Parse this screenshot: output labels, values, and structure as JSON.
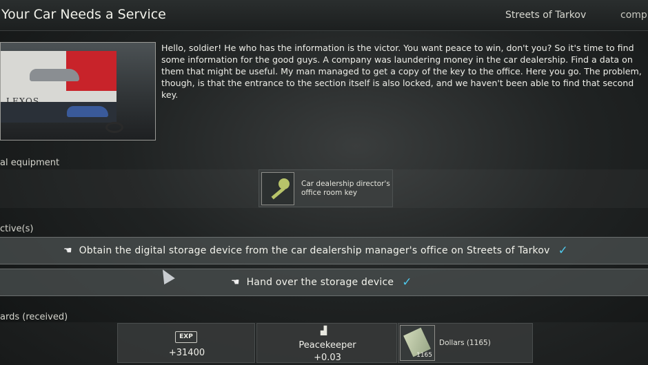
{
  "header": {
    "title": "Your Car Needs a Service",
    "location": "Streets of Tarkov",
    "status": "comp"
  },
  "briefing": {
    "image_text": "LEXOS",
    "description": "Hello, soldier! He who has the information is the victor. You want peace to win, don't you? So it's time to find some information for the good guys. A company was laundering money in the car dealership. Find a data on them that might be useful. My man managed to get a copy of the key to the office. Here you go. The problem, though, is that the entrance to the section itself is also locked, and we haven't been able to find that second key."
  },
  "equipment": {
    "label": "al equipment",
    "items": [
      {
        "name": "Car dealership director's office room key",
        "icon": "key-icon"
      }
    ]
  },
  "objectives": {
    "label": "ctive(s)",
    "items": [
      {
        "text": "Obtain the digital storage device from the car dealership manager's office on Streets of Tarkov",
        "complete": true
      },
      {
        "text": "Hand over the storage device",
        "complete": true
      }
    ]
  },
  "rewards": {
    "label": "ards",
    "status": "(received)",
    "exp": {
      "badge": "EXP",
      "value": "+31400"
    },
    "reputation": {
      "trader": "Peacekeeper",
      "value": "+0.03"
    },
    "item": {
      "name": "Dollars (1165)",
      "count": "1165",
      "icon": "dollars-icon"
    }
  },
  "colors": {
    "check": "#4fc9ec",
    "accent_red": "#c8232a"
  }
}
